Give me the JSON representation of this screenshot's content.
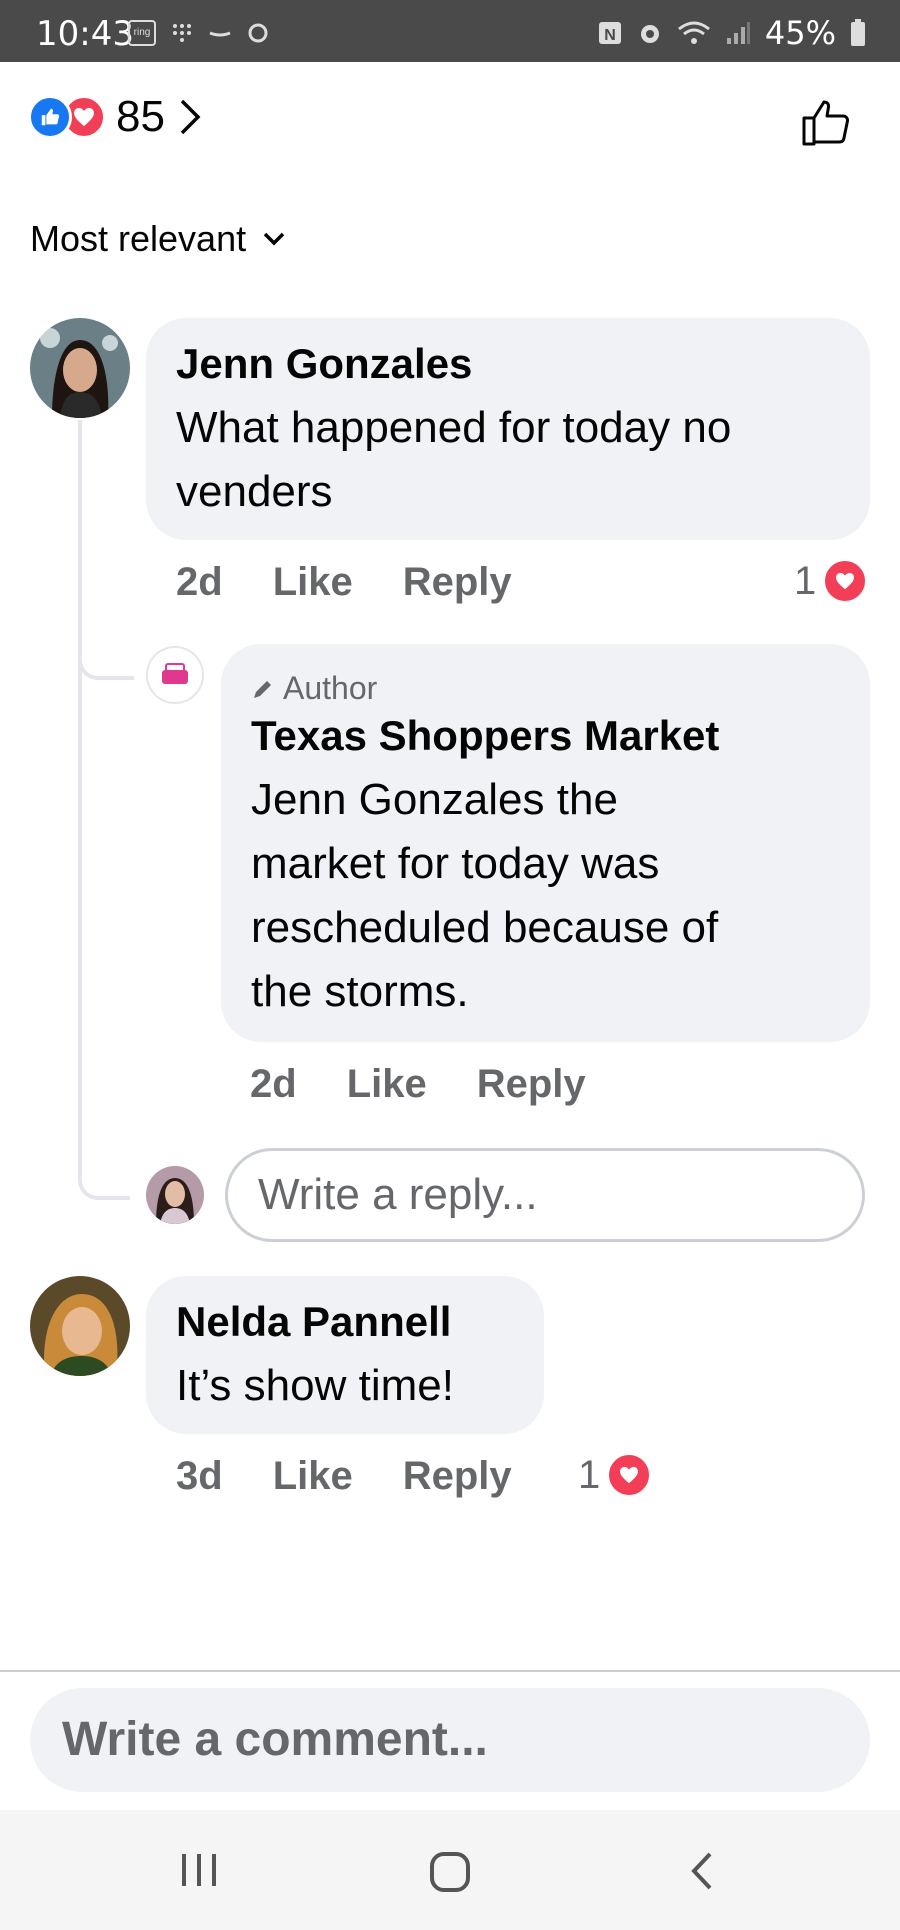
{
  "status_bar": {
    "time": "10:43",
    "battery": "45%",
    "ring_label": "ring"
  },
  "reactions": {
    "count": "85"
  },
  "sort": {
    "label": "Most relevant"
  },
  "comments": [
    {
      "name": "Jenn Gonzales",
      "text_line1": "What happened for today no",
      "text_line2": "venders",
      "time": "2d",
      "like": "Like",
      "reply": "Reply",
      "reaction_count": "1",
      "replies": [
        {
          "badge": "Author",
          "name": "Texas Shoppers Market",
          "text_line1": "Jenn Gonzales the",
          "text_line2": "market for today was",
          "text_line3": "rescheduled because of",
          "text_line4": "the storms.",
          "time": "2d",
          "like": "Like",
          "reply": "Reply"
        }
      ]
    },
    {
      "name": "Nelda Pannell",
      "text_line1": "It’s show time!",
      "time": "3d",
      "like": "Like",
      "reply": "Reply",
      "reaction_count": "1"
    }
  ],
  "reply_input": {
    "placeholder": "Write a reply..."
  },
  "comment_input": {
    "placeholder": "Write a comment..."
  },
  "colors": {
    "like_blue": "#1877f2",
    "love_red": "#f33e58",
    "bubble_bg": "#f0f2f5",
    "meta_gray": "#65676b"
  }
}
